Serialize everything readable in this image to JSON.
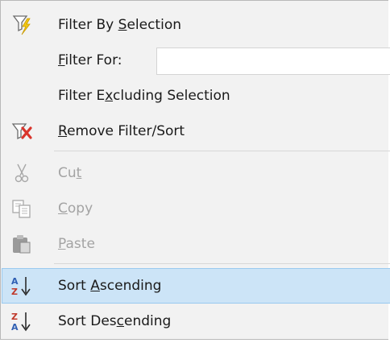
{
  "menu": {
    "items": [
      {
        "id": "filter-by-selection",
        "pre": "Filter By ",
        "accel": "S",
        "post": "election",
        "enabled": true,
        "icon": "filter-lightning-icon"
      },
      {
        "id": "filter-for",
        "pre": "",
        "accel": "F",
        "post": "ilter For:",
        "enabled": true,
        "icon": ""
      },
      {
        "id": "filter-excluding-selection",
        "pre": "Filter E",
        "accel": "x",
        "post": "cluding Selection",
        "enabled": true,
        "icon": ""
      },
      {
        "id": "remove-filter-sort",
        "pre": "",
        "accel": "R",
        "post": "emove Filter/Sort",
        "enabled": true,
        "icon": "filter-remove-icon"
      },
      {
        "id": "cut",
        "pre": "Cu",
        "accel": "t",
        "post": "",
        "enabled": false,
        "icon": "scissors-icon"
      },
      {
        "id": "copy",
        "pre": "",
        "accel": "C",
        "post": "opy",
        "enabled": false,
        "icon": "copy-icon"
      },
      {
        "id": "paste",
        "pre": "",
        "accel": "P",
        "post": "aste",
        "enabled": false,
        "icon": "paste-icon"
      },
      {
        "id": "sort-ascending",
        "pre": "Sort ",
        "accel": "A",
        "post": "scending",
        "enabled": true,
        "icon": "sort-ascending-icon"
      },
      {
        "id": "sort-descending",
        "pre": "Sort Des",
        "accel": "c",
        "post": "ending",
        "enabled": true,
        "icon": "sort-descending-icon"
      }
    ],
    "filter_for_value": "",
    "colors": {
      "background": "#f2f2f2",
      "highlight": "#cce4f7",
      "highlight_border": "#99c9ef",
      "text": "#1a1a1a",
      "disabled_text": "#a3a3a3",
      "separator": "#d7d7d7"
    }
  }
}
